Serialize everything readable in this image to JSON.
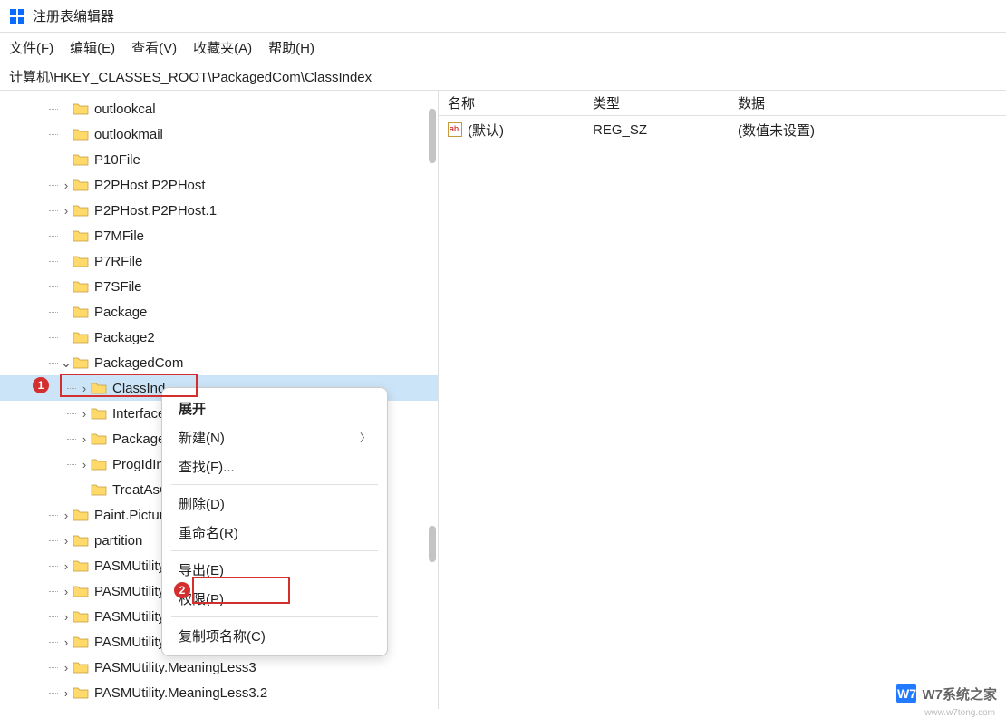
{
  "window": {
    "title": "注册表编辑器"
  },
  "menu": {
    "file": "文件(F)",
    "edit": "编辑(E)",
    "view": "查看(V)",
    "favorites": "收藏夹(A)",
    "help": "帮助(H)"
  },
  "address": "计算机\\HKEY_CLASSES_ROOT\\PackagedCom\\ClassIndex",
  "tree": [
    {
      "label": "outlookcal",
      "indent": 3,
      "exp": ""
    },
    {
      "label": "outlookmail",
      "indent": 3,
      "exp": ""
    },
    {
      "label": "P10File",
      "indent": 3,
      "exp": ""
    },
    {
      "label": "P2PHost.P2PHost",
      "indent": 3,
      "exp": ">"
    },
    {
      "label": "P2PHost.P2PHost.1",
      "indent": 3,
      "exp": ">"
    },
    {
      "label": "P7MFile",
      "indent": 3,
      "exp": ""
    },
    {
      "label": "P7RFile",
      "indent": 3,
      "exp": ""
    },
    {
      "label": "P7SFile",
      "indent": 3,
      "exp": ""
    },
    {
      "label": "Package",
      "indent": 3,
      "exp": ""
    },
    {
      "label": "Package2",
      "indent": 3,
      "exp": ""
    },
    {
      "label": "PackagedCom",
      "indent": 3,
      "exp": "v"
    },
    {
      "label": "ClassInd",
      "indent": 4,
      "exp": ">",
      "selected": true,
      "truncated": true
    },
    {
      "label": "Interface",
      "indent": 4,
      "exp": ">"
    },
    {
      "label": "Package",
      "indent": 4,
      "exp": ">"
    },
    {
      "label": "ProgIdIn",
      "indent": 4,
      "exp": ">"
    },
    {
      "label": "TreatAsC",
      "indent": 4,
      "exp": ""
    },
    {
      "label": "Paint.Pictur",
      "indent": 3,
      "exp": ">"
    },
    {
      "label": "partition",
      "indent": 3,
      "exp": ">"
    },
    {
      "label": "PASMUtility",
      "indent": 3,
      "exp": ">"
    },
    {
      "label": "PASMUtility",
      "indent": 3,
      "exp": ">"
    },
    {
      "label": "PASMUtility",
      "indent": 3,
      "exp": ">"
    },
    {
      "label": "PASMUtility",
      "indent": 3,
      "exp": ">"
    },
    {
      "label": "PASMUtility.MeaningLess3",
      "indent": 3,
      "exp": ">"
    },
    {
      "label": "PASMUtility.MeaningLess3.2",
      "indent": 3,
      "exp": ">"
    }
  ],
  "list": {
    "headers": {
      "name": "名称",
      "type": "类型",
      "data": "数据"
    },
    "rows": [
      {
        "name": "(默认)",
        "type": "REG_SZ",
        "data": "(数值未设置)"
      }
    ]
  },
  "context_menu": {
    "expand": "展开",
    "new": "新建(N)",
    "find": "查找(F)...",
    "delete": "删除(D)",
    "rename": "重命名(R)",
    "export": "导出(E)",
    "permissions": "权限(P)...",
    "copy_key_name": "复制项名称(C)"
  },
  "watermark": {
    "icon": "W7",
    "text": "W7系统之家",
    "sub": "www.w7tong.com"
  }
}
